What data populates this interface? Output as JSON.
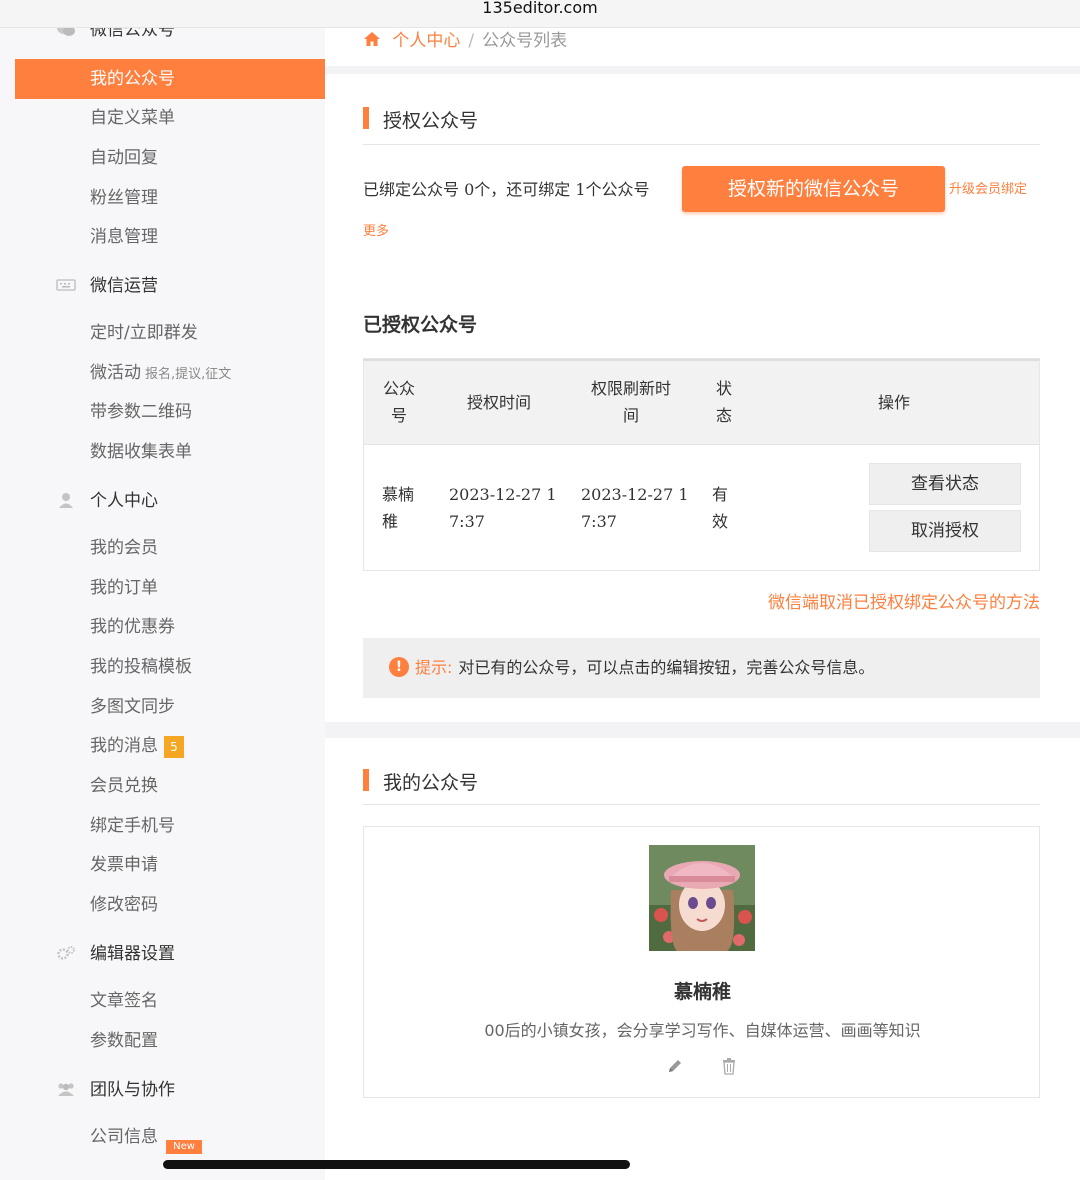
{
  "browser": {
    "url": "135editor.com"
  },
  "sidebar": {
    "top_partial": "微信公众号",
    "wx_items": [
      {
        "label": "我的公众号"
      },
      {
        "label": "自定义菜单"
      },
      {
        "label": "自动回复"
      },
      {
        "label": "粉丝管理"
      },
      {
        "label": "消息管理"
      }
    ],
    "ops_group": "微信运营",
    "ops_items": [
      {
        "label": "定时/立即群发"
      },
      {
        "label": "微活动",
        "sub": "报名,提议,征文"
      },
      {
        "label": "带参数二维码"
      },
      {
        "label": "数据收集表单"
      }
    ],
    "personal_group": "个人中心",
    "personal_items": [
      {
        "label": "我的会员"
      },
      {
        "label": "我的订单"
      },
      {
        "label": "我的优惠券"
      },
      {
        "label": "我的投稿模板"
      },
      {
        "label": "多图文同步"
      },
      {
        "label": "我的消息",
        "badge": "5"
      },
      {
        "label": "会员兑换"
      },
      {
        "label": "绑定手机号"
      },
      {
        "label": "发票申请"
      },
      {
        "label": "修改密码"
      }
    ],
    "editor_group": "编辑器设置",
    "editor_items": [
      {
        "label": "文章签名"
      },
      {
        "label": "参数配置"
      }
    ],
    "team_group": "团队与协作",
    "team_items": [
      {
        "label": "公司信息"
      }
    ],
    "new_tag": "New"
  },
  "breadcrumb": {
    "home": "个人中心",
    "separator": "/",
    "current": "公众号列表"
  },
  "authorize": {
    "title": "授权公众号",
    "bind_status": "已绑定公众号 0个，还可绑定 1个公众号",
    "button": "授权新的微信公众号",
    "upgrade_link": "升级会员绑定",
    "upgrade_more": "更多"
  },
  "authorized": {
    "title": "已授权公众号",
    "headers": [
      {
        "l1": "公众",
        "l2": "号"
      },
      {
        "l1": "授权时间",
        "l2": ""
      },
      {
        "l1": "权限刷新时",
        "l2": "间"
      },
      {
        "l1": "状",
        "l2": "态"
      },
      {
        "l1": "操作",
        "l2": ""
      }
    ],
    "row": {
      "name1": "慕楠",
      "name2": "稚",
      "auth1": "2023-12-27 1",
      "auth2": "7:37",
      "refresh1": "2023-12-27 1",
      "refresh2": "7:37",
      "status1": "有",
      "status2": "效",
      "btn_view": "查看状态",
      "btn_cancel": "取消授权"
    },
    "cancel_method_link": "微信端取消已授权绑定公众号的方法",
    "tip_label": "提示:",
    "tip_text": "对已有的公众号，可以点击的编辑按钮，完善公众号信息。"
  },
  "my_accounts": {
    "title": "我的公众号",
    "account_name": "慕楠稚",
    "account_desc": "00后的小镇女孩，会分享学习写作、自媒体运营、画画等知识"
  },
  "colors": {
    "accent": "#ff7f3f",
    "badge": "#f5a623"
  }
}
